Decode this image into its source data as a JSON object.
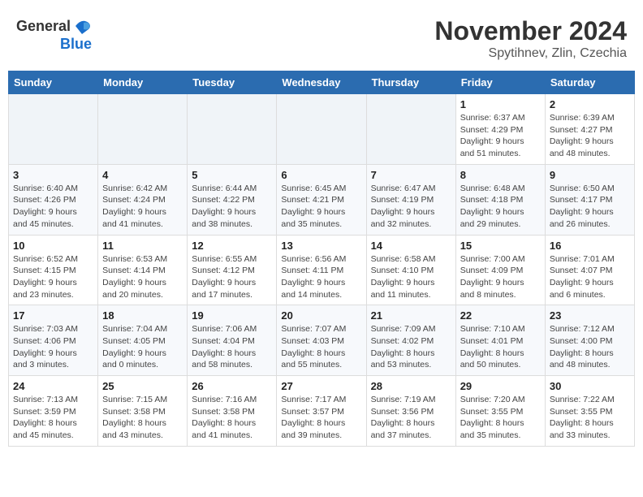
{
  "logo": {
    "text_general": "General",
    "text_blue": "Blue"
  },
  "header": {
    "month_title": "November 2024",
    "subtitle": "Spytihnev, Zlin, Czechia"
  },
  "weekdays": [
    "Sunday",
    "Monday",
    "Tuesday",
    "Wednesday",
    "Thursday",
    "Friday",
    "Saturday"
  ],
  "weeks": [
    [
      {
        "day": "",
        "info": ""
      },
      {
        "day": "",
        "info": ""
      },
      {
        "day": "",
        "info": ""
      },
      {
        "day": "",
        "info": ""
      },
      {
        "day": "",
        "info": ""
      },
      {
        "day": "1",
        "info": "Sunrise: 6:37 AM\nSunset: 4:29 PM\nDaylight: 9 hours and 51 minutes."
      },
      {
        "day": "2",
        "info": "Sunrise: 6:39 AM\nSunset: 4:27 PM\nDaylight: 9 hours and 48 minutes."
      }
    ],
    [
      {
        "day": "3",
        "info": "Sunrise: 6:40 AM\nSunset: 4:26 PM\nDaylight: 9 hours and 45 minutes."
      },
      {
        "day": "4",
        "info": "Sunrise: 6:42 AM\nSunset: 4:24 PM\nDaylight: 9 hours and 41 minutes."
      },
      {
        "day": "5",
        "info": "Sunrise: 6:44 AM\nSunset: 4:22 PM\nDaylight: 9 hours and 38 minutes."
      },
      {
        "day": "6",
        "info": "Sunrise: 6:45 AM\nSunset: 4:21 PM\nDaylight: 9 hours and 35 minutes."
      },
      {
        "day": "7",
        "info": "Sunrise: 6:47 AM\nSunset: 4:19 PM\nDaylight: 9 hours and 32 minutes."
      },
      {
        "day": "8",
        "info": "Sunrise: 6:48 AM\nSunset: 4:18 PM\nDaylight: 9 hours and 29 minutes."
      },
      {
        "day": "9",
        "info": "Sunrise: 6:50 AM\nSunset: 4:17 PM\nDaylight: 9 hours and 26 minutes."
      }
    ],
    [
      {
        "day": "10",
        "info": "Sunrise: 6:52 AM\nSunset: 4:15 PM\nDaylight: 9 hours and 23 minutes."
      },
      {
        "day": "11",
        "info": "Sunrise: 6:53 AM\nSunset: 4:14 PM\nDaylight: 9 hours and 20 minutes."
      },
      {
        "day": "12",
        "info": "Sunrise: 6:55 AM\nSunset: 4:12 PM\nDaylight: 9 hours and 17 minutes."
      },
      {
        "day": "13",
        "info": "Sunrise: 6:56 AM\nSunset: 4:11 PM\nDaylight: 9 hours and 14 minutes."
      },
      {
        "day": "14",
        "info": "Sunrise: 6:58 AM\nSunset: 4:10 PM\nDaylight: 9 hours and 11 minutes."
      },
      {
        "day": "15",
        "info": "Sunrise: 7:00 AM\nSunset: 4:09 PM\nDaylight: 9 hours and 8 minutes."
      },
      {
        "day": "16",
        "info": "Sunrise: 7:01 AM\nSunset: 4:07 PM\nDaylight: 9 hours and 6 minutes."
      }
    ],
    [
      {
        "day": "17",
        "info": "Sunrise: 7:03 AM\nSunset: 4:06 PM\nDaylight: 9 hours and 3 minutes."
      },
      {
        "day": "18",
        "info": "Sunrise: 7:04 AM\nSunset: 4:05 PM\nDaylight: 9 hours and 0 minutes."
      },
      {
        "day": "19",
        "info": "Sunrise: 7:06 AM\nSunset: 4:04 PM\nDaylight: 8 hours and 58 minutes."
      },
      {
        "day": "20",
        "info": "Sunrise: 7:07 AM\nSunset: 4:03 PM\nDaylight: 8 hours and 55 minutes."
      },
      {
        "day": "21",
        "info": "Sunrise: 7:09 AM\nSunset: 4:02 PM\nDaylight: 8 hours and 53 minutes."
      },
      {
        "day": "22",
        "info": "Sunrise: 7:10 AM\nSunset: 4:01 PM\nDaylight: 8 hours and 50 minutes."
      },
      {
        "day": "23",
        "info": "Sunrise: 7:12 AM\nSunset: 4:00 PM\nDaylight: 8 hours and 48 minutes."
      }
    ],
    [
      {
        "day": "24",
        "info": "Sunrise: 7:13 AM\nSunset: 3:59 PM\nDaylight: 8 hours and 45 minutes."
      },
      {
        "day": "25",
        "info": "Sunrise: 7:15 AM\nSunset: 3:58 PM\nDaylight: 8 hours and 43 minutes."
      },
      {
        "day": "26",
        "info": "Sunrise: 7:16 AM\nSunset: 3:58 PM\nDaylight: 8 hours and 41 minutes."
      },
      {
        "day": "27",
        "info": "Sunrise: 7:17 AM\nSunset: 3:57 PM\nDaylight: 8 hours and 39 minutes."
      },
      {
        "day": "28",
        "info": "Sunrise: 7:19 AM\nSunset: 3:56 PM\nDaylight: 8 hours and 37 minutes."
      },
      {
        "day": "29",
        "info": "Sunrise: 7:20 AM\nSunset: 3:55 PM\nDaylight: 8 hours and 35 minutes."
      },
      {
        "day": "30",
        "info": "Sunrise: 7:22 AM\nSunset: 3:55 PM\nDaylight: 8 hours and 33 minutes."
      }
    ]
  ]
}
